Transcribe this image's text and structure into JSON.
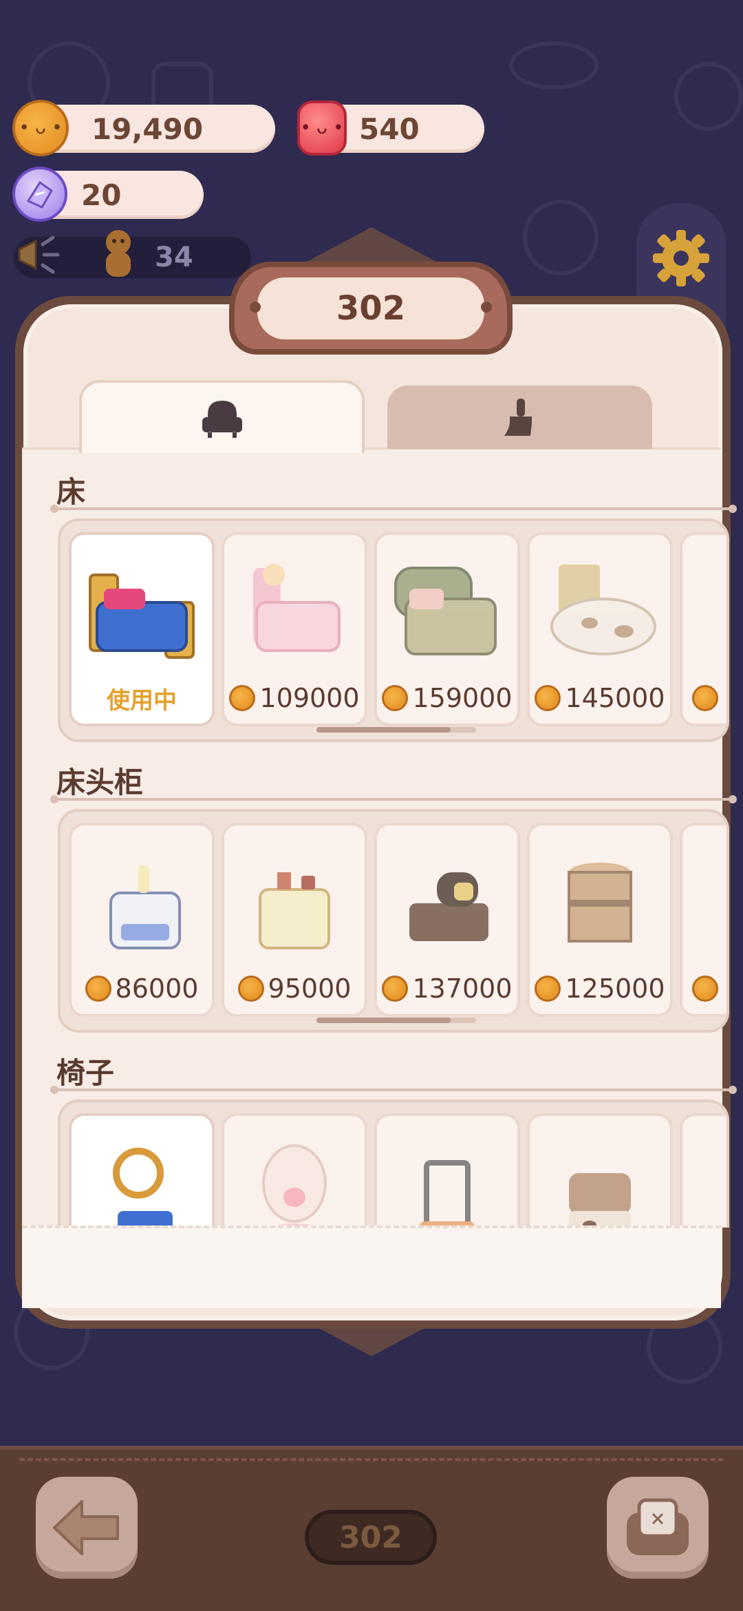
{
  "currencies": {
    "coins": {
      "icon": "cookie-coin-icon",
      "value": "19,490"
    },
    "jelly": {
      "icon": "jelly-candle-icon",
      "value": "540"
    },
    "crystal": {
      "icon": "crystal-candy-icon",
      "value": "20"
    }
  },
  "notice": {
    "icon": "megaphone-icon",
    "figure_icon": "gingerbread-icon",
    "value": "34"
  },
  "settings": {
    "icon": "gear-icon"
  },
  "room": {
    "number": "302"
  },
  "tabs": [
    {
      "icon": "armchair-icon",
      "active": true
    },
    {
      "icon": "paint-brush-icon",
      "active": false
    }
  ],
  "sections": [
    {
      "title": "床",
      "items": [
        {
          "status": "使用中",
          "owned": true,
          "color": "#3f6fd1"
        },
        {
          "price": "109000",
          "owned": false,
          "color": "#f3b9c8"
        },
        {
          "price": "159000",
          "owned": false,
          "color": "#8f9a6d"
        },
        {
          "price": "145000",
          "owned": false,
          "color": "#e8ddd0"
        }
      ]
    },
    {
      "title": "床头柜",
      "items": [
        {
          "price": "86000",
          "owned": false,
          "color": "#cfe0f5"
        },
        {
          "price": "95000",
          "owned": false,
          "color": "#f5e3a8"
        },
        {
          "price": "137000",
          "owned": false,
          "color": "#6b5040"
        },
        {
          "price": "125000",
          "owned": false,
          "color": "#c9a37b"
        }
      ]
    },
    {
      "title": "椅子",
      "items": [
        {
          "owned": true,
          "color": "#d89a3a"
        },
        {
          "owned": false,
          "color": "#f5c9cf"
        },
        {
          "owned": false,
          "color": "#6a6a6a"
        },
        {
          "owned": false,
          "color": "#b58f72"
        }
      ]
    }
  ],
  "bottom": {
    "room_label": "302",
    "back_icon": "back-arrow-icon",
    "room_icon": "tv-sofa-icon"
  },
  "colors": {
    "background": "#2f2a4f",
    "panel": "#f4e6dc",
    "accent": "#e5a12b",
    "frame": "#6b4b3e"
  }
}
